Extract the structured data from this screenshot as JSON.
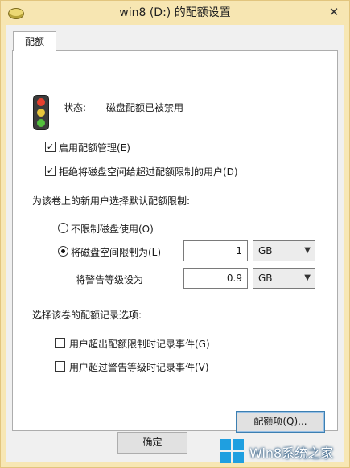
{
  "window": {
    "title": "win8 (D:) 的配额设置",
    "close_glyph": "✕"
  },
  "tab": {
    "label": "配额"
  },
  "status": {
    "label": "状态:",
    "value": "磁盘配额已被禁用"
  },
  "options": {
    "enable_quota": {
      "label": "启用配额管理(E)",
      "checked": true
    },
    "deny_space": {
      "label": "拒绝将磁盘空间给超过配额限制的用户(D)",
      "checked": true
    }
  },
  "defaults_heading": "为该卷上的新用户选择默认配额限制:",
  "radio_unlimited": {
    "label": "不限制磁盘使用(O)",
    "selected": false
  },
  "radio_limit": {
    "label": "将磁盘空间限制为(L)",
    "selected": true
  },
  "limit": {
    "value": "1",
    "unit": "GB"
  },
  "warning": {
    "label": "将警告等级设为",
    "value": "0.9",
    "unit": "GB"
  },
  "logging_heading": "选择该卷的配额记录选项:",
  "log_over_limit": {
    "label": "用户超出配额限制时记录事件(G)",
    "checked": false
  },
  "log_over_warning": {
    "label": "用户超过警告等级时记录事件(V)",
    "checked": false
  },
  "quota_entries_button": "配额项(Q)...",
  "ok_button": "确定",
  "watermark": {
    "text": "Win8系统之家"
  },
  "colors": {
    "title_bar": "#f7e6b2",
    "accent": "#1f9fe0"
  }
}
